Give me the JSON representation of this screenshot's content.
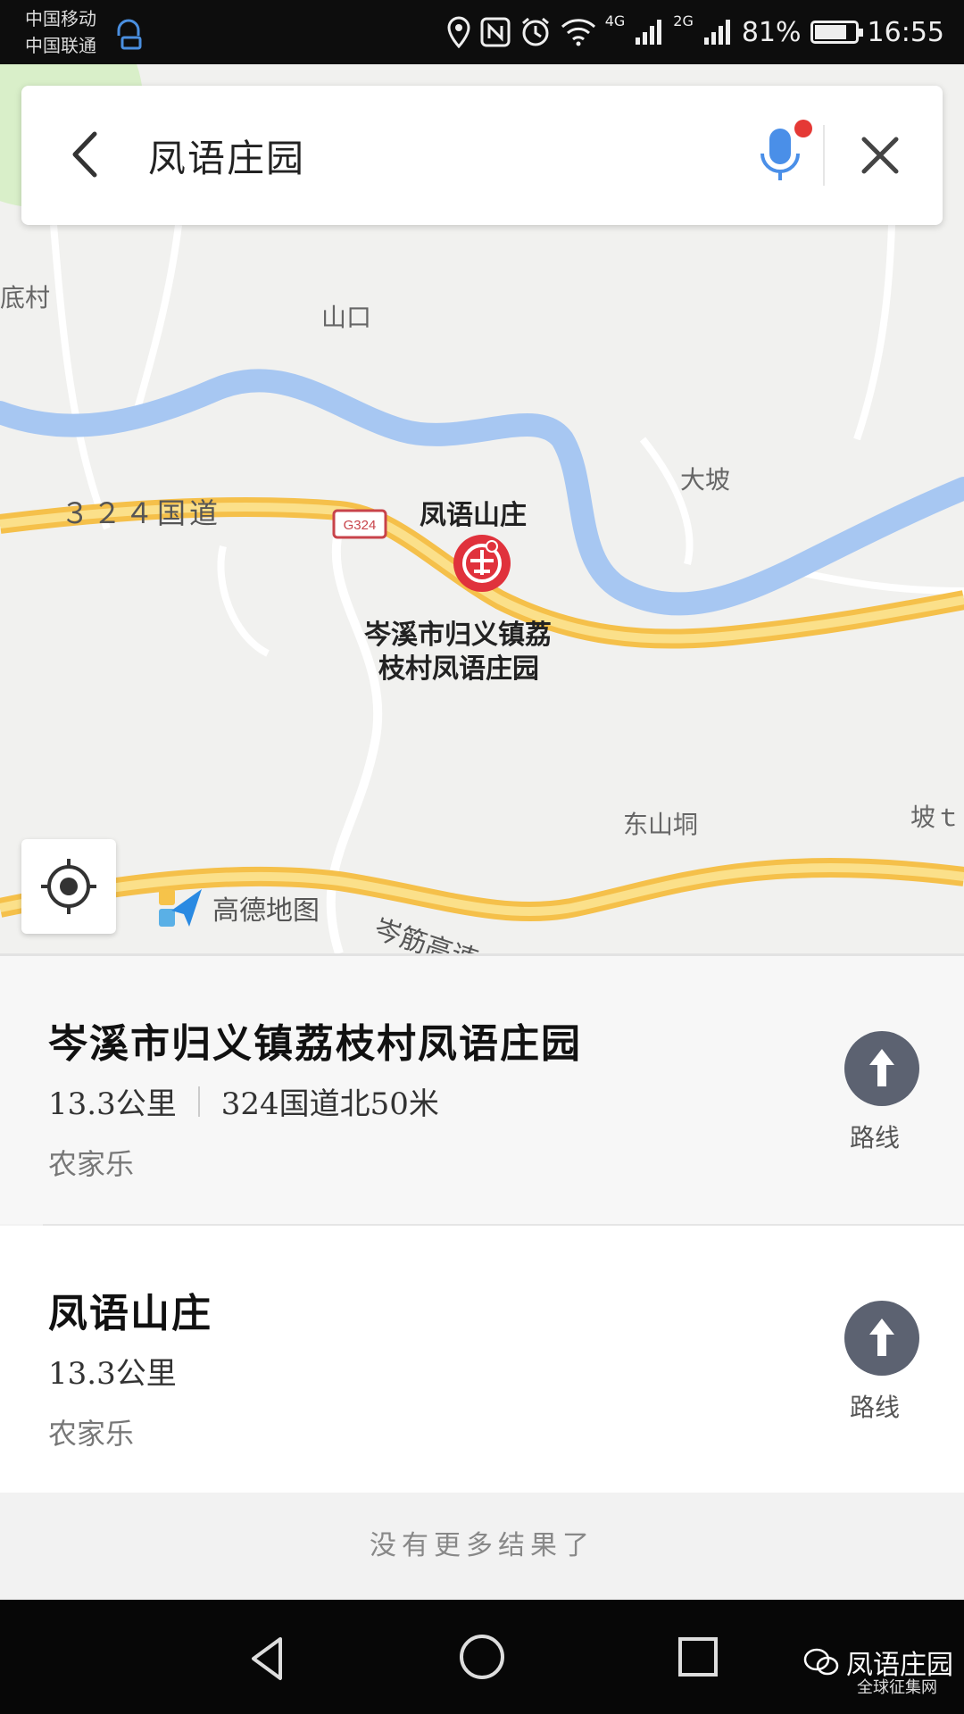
{
  "status_bar": {
    "carrier_1": "中国移动",
    "carrier_2": "中国联通",
    "network_1": "4G",
    "network_2": "2G",
    "battery_percent": "81%",
    "battery_level": 0.81,
    "time": "16:55"
  },
  "search": {
    "query": "凤语庄园",
    "back_icon": "chevron-left-icon",
    "mic_icon": "microphone-icon",
    "close_icon": "close-icon"
  },
  "map": {
    "labels": {
      "village_left": "底村",
      "shankou": "山口",
      "highway_label": "３２４国道",
      "road_sign": "G324",
      "dapo": "大坡",
      "poi_top": "凤语山庄",
      "poi_bottom_line1": "岑溪市归义镇荔",
      "poi_bottom_line2": "枝村凤语庄园",
      "dongshan": "东山垌",
      "pobian": "坡ｔ",
      "expressway": "岑筋高速"
    },
    "logo_text": "高德地图",
    "colors": {
      "river": "#a7c7f2",
      "highway": "#f5c04a",
      "pin": "#e0323c"
    }
  },
  "results": [
    {
      "title": "岑溪市归义镇荔枝村凤语庄园",
      "distance": "13.3公里",
      "address": "324国道北50米",
      "category": "农家乐",
      "route_label": "路线"
    },
    {
      "title": "凤语山庄",
      "distance": "13.3公里",
      "address": "",
      "category": "农家乐",
      "route_label": "路线"
    }
  ],
  "no_more_results": "没有更多结果了",
  "watermark": {
    "title": "凤语庄园",
    "subtitle": "全球征集网"
  }
}
